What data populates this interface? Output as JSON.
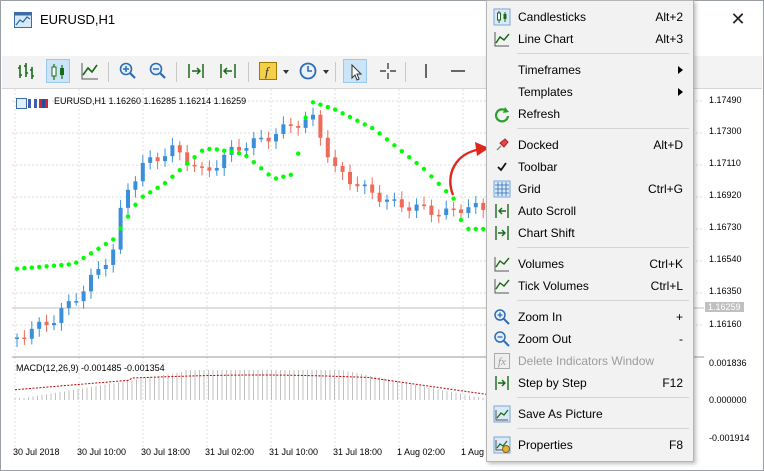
{
  "window": {
    "title": "EURUSD,H1",
    "close_glyph": "✕"
  },
  "chart": {
    "header": "EURUSD,H1  1.16260 1.16285 1.16214 1.16259",
    "indicator": "MACD(12,26,9) -0.001485 -0.001354",
    "price_labels": [
      "1.17490",
      "1.17300",
      "1.17110",
      "1.16920",
      "1.16730",
      "1.16540",
      "1.16350",
      "1.16259",
      "1.16160"
    ],
    "current_price": "1.16259",
    "macd_labels": [
      "0.001836",
      "0.000000",
      "-0.001914"
    ],
    "time_labels": [
      "30 Jul 2018",
      "30 Jul 10:00",
      "30 Jul 18:00",
      "31 Jul 02:00",
      "31 Jul 10:00",
      "31 Jul 18:00",
      "1 Aug 02:00",
      "1 Aug"
    ],
    "colors": {
      "bull": "#3a8fd8",
      "bear": "#ef6a57",
      "sar": "#00ff00",
      "macd": "#c0c0c0",
      "signal": "#c00000",
      "grid": "#dcdcdc",
      "current": "#c0c0c0"
    }
  },
  "toolbar": {
    "icons": [
      "bar-chart-icon",
      "candlesticks-icon",
      "line-chart-icon",
      "zoom-in-icon",
      "zoom-out-icon",
      "chart-shift-icon",
      "auto-scroll-icon",
      "indicators-icon",
      "periodicity-icon",
      "cursor-icon",
      "crosshair-icon",
      "vertical-line-icon",
      "horizontal-line-icon"
    ]
  },
  "menu": {
    "items": [
      {
        "label": "Candlesticks",
        "shortcut": "Alt+2",
        "icon": "candlesticks-icon"
      },
      {
        "label": "Line Chart",
        "shortcut": "Alt+3",
        "icon": "line-chart-icon"
      },
      {
        "label": "Timeframes",
        "shortcut": "",
        "icon": ""
      },
      {
        "label": "Templates",
        "shortcut": "",
        "icon": ""
      },
      {
        "label": "Refresh",
        "shortcut": "",
        "icon": "refresh-icon"
      },
      {
        "label": "Docked",
        "shortcut": "Alt+D",
        "icon": "pin-icon"
      },
      {
        "label": "Toolbar",
        "shortcut": "",
        "icon": "check-icon"
      },
      {
        "label": "Grid",
        "shortcut": "Ctrl+G",
        "icon": "grid-icon"
      },
      {
        "label": "Auto Scroll",
        "shortcut": "",
        "icon": "auto-scroll-icon"
      },
      {
        "label": "Chart Shift",
        "shortcut": "",
        "icon": "chart-shift-icon"
      },
      {
        "label": "Volumes",
        "shortcut": "Ctrl+K",
        "icon": "volumes-icon"
      },
      {
        "label": "Tick Volumes",
        "shortcut": "Ctrl+L",
        "icon": "tick-volumes-icon"
      },
      {
        "label": "Zoom In",
        "shortcut": "+",
        "icon": "zoom-in-icon"
      },
      {
        "label": "Zoom Out",
        "shortcut": "-",
        "icon": "zoom-out-icon"
      },
      {
        "label": "Delete Indicators Window",
        "shortcut": "",
        "icon": "delete-indicators-icon"
      },
      {
        "label": "Step by Step",
        "shortcut": "F12",
        "icon": "step-icon"
      },
      {
        "label": "Save As Picture",
        "shortcut": "",
        "icon": "save-picture-icon"
      },
      {
        "label": "Properties",
        "shortcut": "F8",
        "icon": "properties-icon"
      }
    ]
  }
}
